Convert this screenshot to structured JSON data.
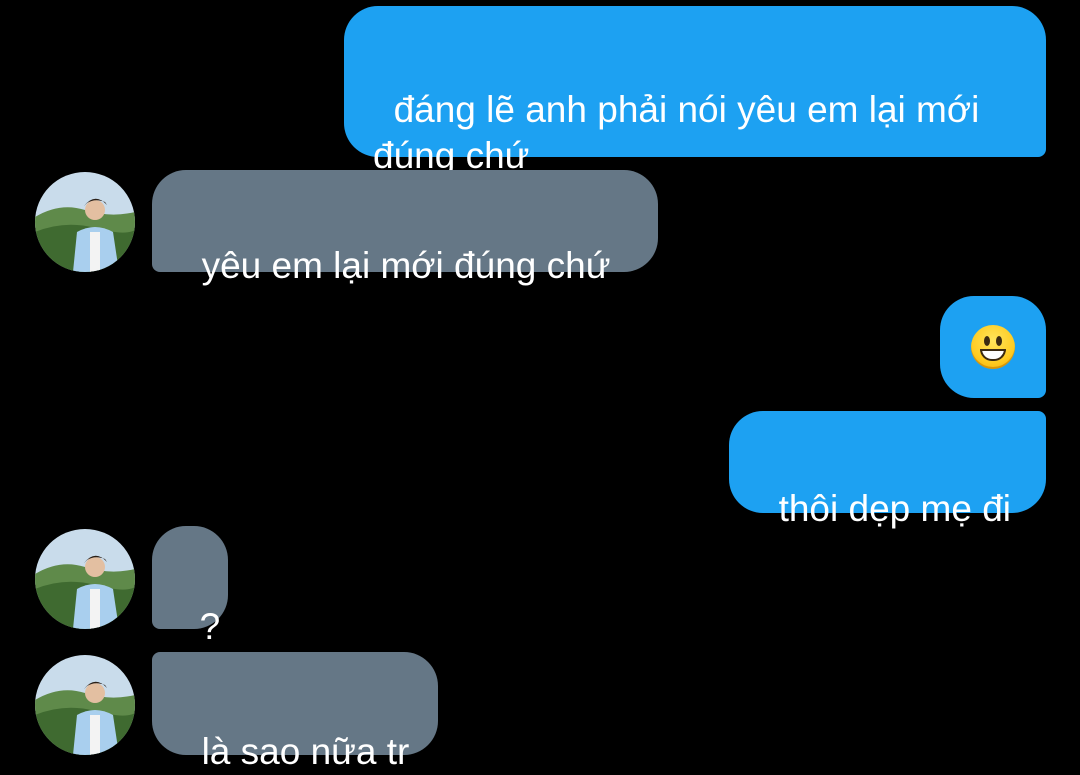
{
  "chat": {
    "messages": [
      {
        "direction": "outgoing",
        "text": "đáng lẽ anh phải nói yêu em lại mới\nđúng chứ"
      },
      {
        "direction": "incoming",
        "text": "yêu em lại mới đúng chứ"
      },
      {
        "direction": "outgoing",
        "emoji": "grinning-face-emoji"
      },
      {
        "direction": "outgoing",
        "text": "thôi dẹp mẹ đi"
      },
      {
        "direction": "incoming",
        "text": "?"
      },
      {
        "direction": "incoming",
        "text": "là sao nữa tr"
      }
    ]
  },
  "colors": {
    "background": "#000000",
    "outgoing_bubble": "#1da1f2",
    "incoming_bubble": "#657786",
    "bubble_text": "#ffffff"
  },
  "icons": {
    "avatar": "contact-avatar-photo"
  }
}
